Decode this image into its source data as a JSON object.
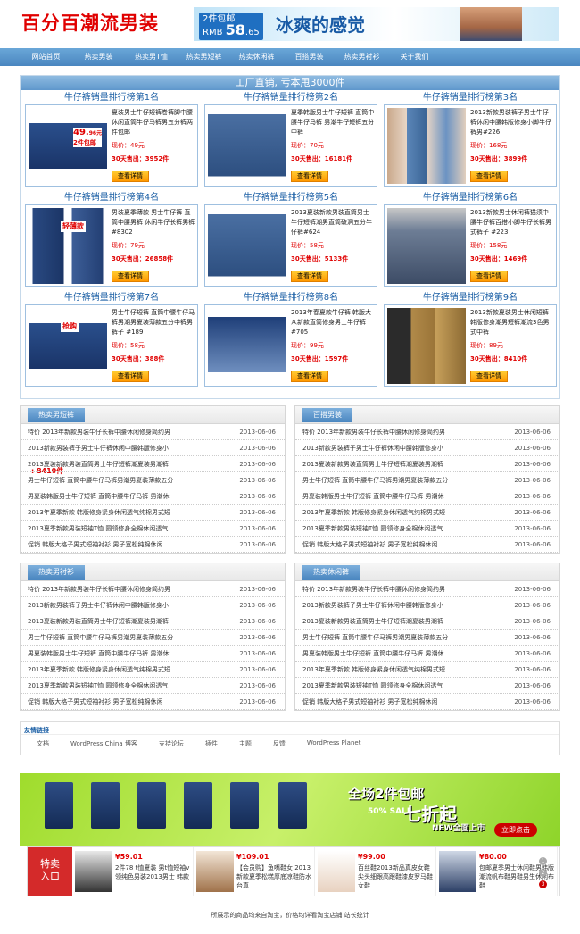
{
  "header": {
    "logo": "百分百潮流男装",
    "banner_price_prefix": "2件包邮",
    "banner_price_label": "RMB",
    "banner_price": "58",
    "banner_price_cents": ".65",
    "banner_slogan": "冰爽的感觉"
  },
  "nav": [
    "网站首页",
    "热卖男装",
    "热卖男T恤",
    "热卖男短裤",
    "热卖休闲裤",
    "百搭男装",
    "热卖男衬衫",
    "关于我们"
  ],
  "main": {
    "title": "工厂直销, 亏本甩3000件",
    "extra": ": 8410件"
  },
  "products": [
    {
      "rank": "牛仔裤销量排行榜第1名",
      "desc": "夏装男士牛仔短裤卷裤脚中腰休闲直筒牛仔马裤男五分裤两件包邮",
      "price": "现价：49元",
      "sold": "30天售出：3952件",
      "btn": "查看详情",
      "img": "blue-shorts",
      "badge": "49.",
      "badge_cents": "96元",
      "badge2": "2件包邮"
    },
    {
      "rank": "牛仔裤销量排行榜第2名",
      "desc": "夏季韩版男士牛仔短裤 直筒中腰牛仔马裤 男潮牛仔短裤五分中裤",
      "price": "现价：70元",
      "sold": "30天售出：16181件",
      "btn": "查看详情",
      "img": "denim-shorts"
    },
    {
      "rank": "牛仔裤销量排行榜第3名",
      "desc": "2013新款男装裤子男士牛仔裤休闲中腰韩版修身小脚牛仔裤男#226",
      "price": "现价：168元",
      "sold": "30天售出：3899件",
      "btn": "查看详情",
      "img": "jeans-models"
    },
    {
      "rank": "牛仔裤销量排行榜第4名",
      "desc": "男装夏季薄款 男士牛仔裤 直筒中腰男裤 休闲牛仔长裤男裤 #8302",
      "price": "现价：79元",
      "sold": "30天售出：26858件",
      "btn": "查看详情",
      "img": "jeans-pair",
      "badge": "轻薄款"
    },
    {
      "rank": "牛仔裤销量排行榜第5名",
      "desc": "2013夏装新款男装直筒男士牛仔短裤潮男直筒破洞五分牛仔裤#624",
      "price": "现价：58元",
      "sold": "30天售出：5133件",
      "btn": "查看详情",
      "img": "denim-shorts"
    },
    {
      "rank": "牛仔裤销量排行榜第6名",
      "desc": "2013新款男士休闲裤猫须中腰牛仔裤百搭小脚牛仔长裤男式裤子 #223",
      "price": "现价：158元",
      "sold": "30天售出：1469件",
      "btn": "查看详情",
      "img": "jeans-grey"
    },
    {
      "rank": "牛仔裤销量排行榜第7名",
      "desc": "男士牛仔短裤 直筒中腰牛仔马裤男潮男夏装薄款五分中裤男裤子 #189",
      "price": "现价：58元",
      "sold": "30天售出：388件",
      "btn": "查看详情",
      "img": "blue-shorts",
      "badge": "抢购"
    },
    {
      "rank": "牛仔裤销量排行榜第8名",
      "desc": "2013年春夏款牛仔裤 韩版大众新款直筒修身男士牛仔裤 #705",
      "price": "现价：99元",
      "sold": "30天售出：1597件",
      "btn": "查看详情",
      "img": "jeans-folded"
    },
    {
      "rank": "牛仔裤销量排行榜第9名",
      "desc": "2013新款夏装男士休闲短裤韩版修身潮男短裤潮流3色男式中裤",
      "price": "现价：89元",
      "sold": "30天售出：8410件",
      "btn": "查看详情",
      "img": "khaki-shorts"
    }
  ],
  "lists": [
    {
      "title": "热卖男短裤",
      "items": [
        {
          "t": "特价 2013年新款男装牛仔长裤中腰休闲修身简约男",
          "d": "2013-06-06"
        },
        {
          "t": "2013新款男装裤子男士牛仔裤休闲中腰韩版修身小",
          "d": "2013-06-06"
        },
        {
          "t": "2013夏装新款男装直筒男士牛仔短裤潮夏装男潮裤",
          "d": "2013-06-06"
        },
        {
          "t": "男士牛仔短裤 直筒中腰牛仔马裤男潮男夏装薄款五分",
          "d": "2013-06-06"
        },
        {
          "t": "男夏装韩版男士牛仔短裤 直筒中腰牛仔马裤 男潮休",
          "d": "2013-06-06"
        },
        {
          "t": "2013年夏季新款 韩版修身紧身休闲透气纯棉男式短",
          "d": "2013-06-06"
        },
        {
          "t": "2013夏季新款男装短袖T恤 圆领修身全棉休闲透气",
          "d": "2013-06-06"
        },
        {
          "t": "促销 韩版大格子男式短袖衬衫 男子宽松纯棉休闲",
          "d": "2013-06-06"
        }
      ]
    },
    {
      "title": "百搭男装",
      "items": [
        {
          "t": "特价 2013年新款男装牛仔长裤中腰休闲修身简约男",
          "d": "2013-06-06"
        },
        {
          "t": "2013新款男装裤子男士牛仔裤休闲中腰韩版修身小",
          "d": "2013-06-06"
        },
        {
          "t": "2013夏装新款男装直筒男士牛仔短裤潮夏装男潮裤",
          "d": "2013-06-06"
        },
        {
          "t": "男士牛仔短裤 直筒中腰牛仔马裤男潮男夏装薄款五分",
          "d": "2013-06-06"
        },
        {
          "t": "男夏装韩版男士牛仔短裤 直筒中腰牛仔马裤 男潮休",
          "d": "2013-06-06"
        },
        {
          "t": "2013年夏季新款 韩版修身紧身休闲透气纯棉男式短",
          "d": "2013-06-06"
        },
        {
          "t": "2013夏季新款男装短袖T恤 圆领修身全棉休闲透气",
          "d": "2013-06-06"
        },
        {
          "t": "促销 韩版大格子男式短袖衬衫 男子宽松纯棉休闲",
          "d": "2013-06-06"
        }
      ]
    },
    {
      "title": "热卖男衬衫",
      "items": [
        {
          "t": "特价 2013年新款男装牛仔长裤中腰休闲修身简约男",
          "d": "2013-06-06"
        },
        {
          "t": "2013新款男装裤子男士牛仔裤休闲中腰韩版修身小",
          "d": "2013-06-06"
        },
        {
          "t": "2013夏装新款男装直筒男士牛仔短裤潮夏装男潮裤",
          "d": "2013-06-06"
        },
        {
          "t": "男士牛仔短裤 直筒中腰牛仔马裤男潮男夏装薄款五分",
          "d": "2013-06-06"
        },
        {
          "t": "男夏装韩版男士牛仔短裤 直筒中腰牛仔马裤 男潮休",
          "d": "2013-06-06"
        },
        {
          "t": "2013年夏季新款 韩版修身紧身休闲透气纯棉男式短",
          "d": "2013-06-06"
        },
        {
          "t": "2013夏季新款男装短袖T恤 圆领修身全棉休闲透气",
          "d": "2013-06-06"
        },
        {
          "t": "促销 韩版大格子男式短袖衬衫 男子宽松纯棉休闲",
          "d": "2013-06-06"
        }
      ]
    },
    {
      "title": "热卖休闲裤",
      "items": [
        {
          "t": "特价 2013年新款男装牛仔长裤中腰休闲修身简约男",
          "d": "2013-06-06"
        },
        {
          "t": "2013新款男装裤子男士牛仔裤休闲中腰韩版修身小",
          "d": "2013-06-06"
        },
        {
          "t": "2013夏装新款男装直筒男士牛仔短裤潮夏装男潮裤",
          "d": "2013-06-06"
        },
        {
          "t": "男士牛仔短裤 直筒中腰牛仔马裤男潮男夏装薄款五分",
          "d": "2013-06-06"
        },
        {
          "t": "男夏装韩版男士牛仔短裤 直筒中腰牛仔马裤 男潮休",
          "d": "2013-06-06"
        },
        {
          "t": "2013年夏季新款 韩版修身紧身休闲透气纯棉男式短",
          "d": "2013-06-06"
        },
        {
          "t": "2013夏季新款男装短袖T恤 圆领修身全棉休闲透气",
          "d": "2013-06-06"
        },
        {
          "t": "促销 韩版大格子男式短袖衬衫 男子宽松纯棉休闲",
          "d": "2013-06-06"
        }
      ]
    }
  ],
  "friend": {
    "title": "友情链接",
    "links": [
      "文档",
      "WordPress China 博客",
      "支持论坛",
      "插件",
      "主题",
      "反馈",
      "WordPress Planet"
    ]
  },
  "bigad": {
    "line1": "全场2件包邮",
    "line2": "七折起",
    "sale": "50% SALE",
    "line3": "NEW全面上市",
    "btn": "立即点击"
  },
  "strip": {
    "label1": "特卖",
    "label2": "入口",
    "items": [
      {
        "price": "¥59.01",
        "desc": "2件78 t恤夏装 男t恤短袖v领纯色男装2013男士 韩款"
      },
      {
        "price": "¥109.01",
        "desc": "【会员购】鱼嘴鞋女 2013新款夏季松糕厚底凉鞋防水台真"
      },
      {
        "price": "¥99.00",
        "desc": "百丝鞋2013新品真皮女鞋尖头细跟高跟鞋漆皮罗马鞋女鞋"
      },
      {
        "price": "¥80.00",
        "desc": "包邮夏季男士休闲鞋男韩版潮流帆布鞋男鞋男生休闲布鞋"
      }
    ],
    "dots": [
      "1",
      "2",
      "3"
    ]
  },
  "footer": "所展示的商品均来自淘宝，价格均详看淘宝店铺 站长统计"
}
